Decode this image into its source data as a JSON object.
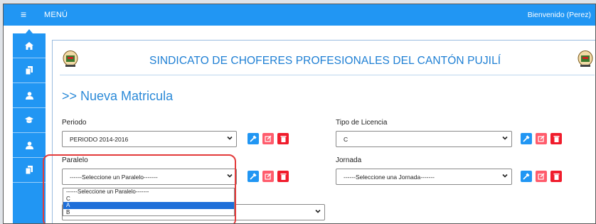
{
  "topbar": {
    "hamburger_icon": "≡",
    "menu_label": "MENÚ",
    "welcome_text": "Bienvenido (Perez)"
  },
  "sidebar": {
    "icons": [
      "home-icon",
      "copy-icon",
      "user-icon",
      "graduation-icon",
      "user-plus-icon",
      "files-icon"
    ]
  },
  "header": {
    "title": "SINDICATO DE CHOFERES PROFESIONALES DEL CANTÓN PUJILÍ"
  },
  "form": {
    "title": ">> Nueva Matricula",
    "periodo": {
      "label": "Periodo",
      "value": "PERIODO 2014-2016"
    },
    "tipo_licencia": {
      "label": "Tipo de Licencia",
      "value": "C"
    },
    "paralelo": {
      "label": "Paralelo",
      "value": "------Seleccione un Paralelo-------"
    },
    "jornada": {
      "label": "Jornada",
      "value": "------Seleccione una Jornada-------"
    },
    "paralelo_options": [
      "------Seleccione un Paralelo-------",
      "C",
      "A",
      "B"
    ],
    "paralelo_highlighted_option": "A"
  },
  "colors": {
    "primary": "#2196f3",
    "danger": "#f01c2c",
    "edit": "#ff5c6c",
    "title_blue": "#1e7fd4",
    "highlight_ring": "#e33a3a"
  }
}
